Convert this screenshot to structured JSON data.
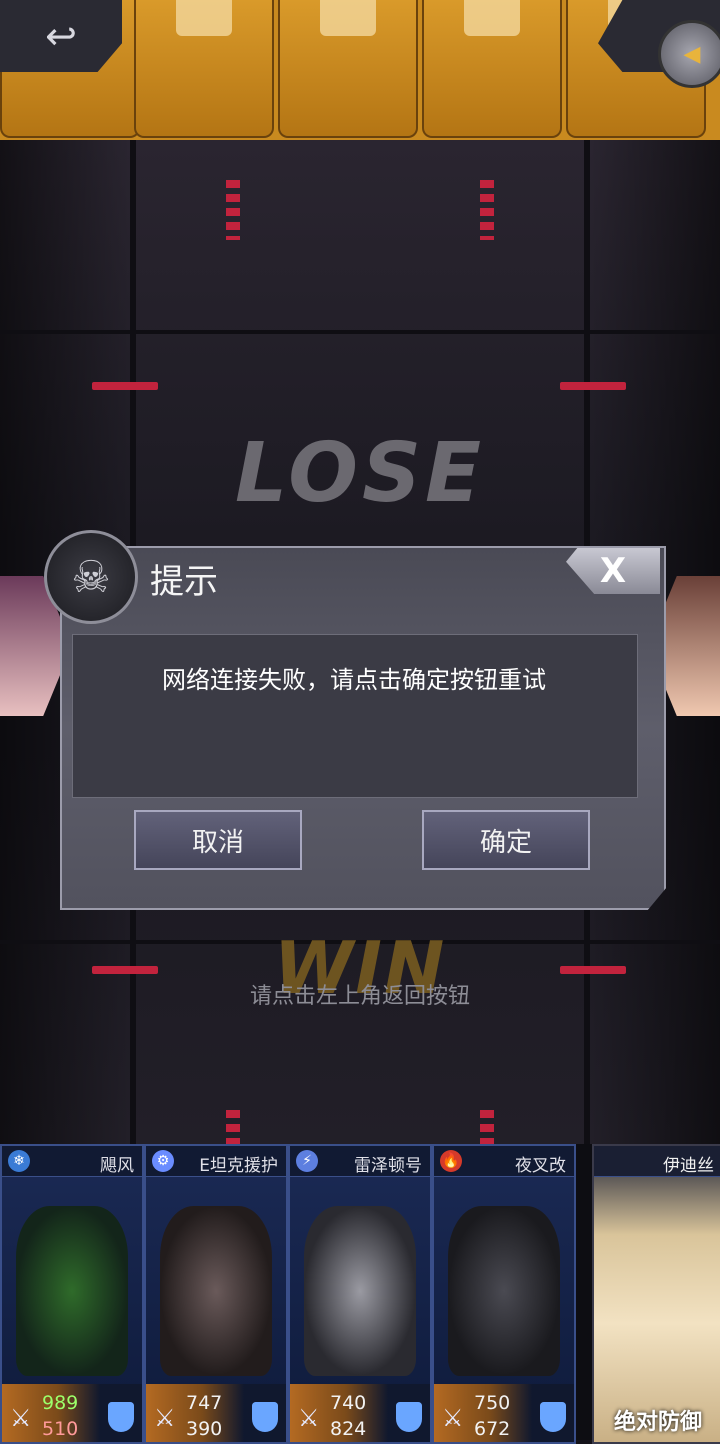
{
  "top": {
    "back_icon": "back-arrow-icon",
    "right_icon": "expand-arrow-icon"
  },
  "stage": {
    "lose": "LOSE",
    "win": "WIN",
    "hint": "请点击左上角返回按钮"
  },
  "dialog": {
    "title": "提示",
    "close_label": "X",
    "message": "网络连接失败，请点击确定按钮重试",
    "cancel_label": "取消",
    "confirm_label": "确定"
  },
  "cards": [
    {
      "name": "飓风",
      "icon": "snowflake-icon",
      "icon_color": "#3a7bd5",
      "atk": "989",
      "def": "510"
    },
    {
      "name": "E坦克援护",
      "icon": "tank-icon",
      "icon_color": "#6a8cff",
      "atk": "747",
      "def": "390"
    },
    {
      "name": "雷泽顿号",
      "icon": "lightning-icon",
      "icon_color": "#5d7fe0",
      "atk": "740",
      "def": "824"
    },
    {
      "name": "夜叉改",
      "icon": "fire-icon",
      "icon_color": "#d53a2a",
      "atk": "750",
      "def": "672"
    }
  ],
  "pilot": {
    "name": "伊迪丝",
    "skill": "绝对防御"
  }
}
